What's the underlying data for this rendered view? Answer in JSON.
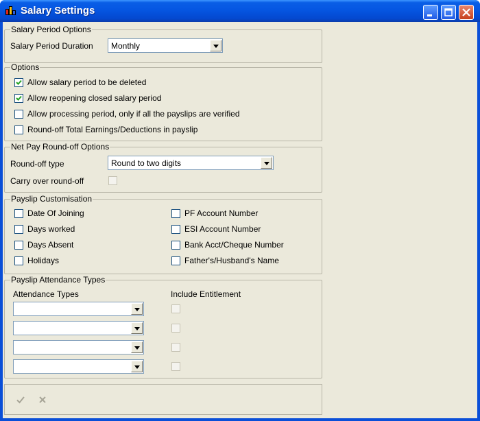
{
  "window": {
    "title": "Salary Settings"
  },
  "salary_period": {
    "legend": "Salary Period Options",
    "duration_label": "Salary Period Duration",
    "duration_value": "Monthly"
  },
  "options": {
    "legend": "Options",
    "items": [
      {
        "label": "Allow salary period to be deleted",
        "checked": true
      },
      {
        "label": "Allow reopening closed salary period",
        "checked": true
      },
      {
        "label": "Allow processing period, only if all the payslips are verified",
        "checked": false
      },
      {
        "label": "Round-off Total Earnings/Deductions in payslip",
        "checked": false
      }
    ]
  },
  "net_pay": {
    "legend": "Net Pay Round-off Options",
    "type_label": "Round-off type",
    "type_value": "Round to two digits",
    "carry_label": "Carry over round-off"
  },
  "payslip_customisation": {
    "legend": "Payslip Customisation",
    "left": [
      "Date Of Joining",
      "Days worked",
      "Days Absent",
      "Holidays"
    ],
    "right": [
      "PF Account Number",
      "ESI Account Number",
      "Bank Acct/Cheque Number",
      "Father's/Husband's Name"
    ]
  },
  "attendance": {
    "legend": "Payslip Attendance Types",
    "col_types": "Attendance Types",
    "col_entitlement": "Include Entitlement",
    "rows": 4
  },
  "toolbar": {
    "ok_icon": "check-icon",
    "cancel_icon": "x-icon"
  },
  "colors": {
    "titlebar": "#0556e2",
    "client": "#ebe9db",
    "group_border": "#b7b5a7"
  }
}
